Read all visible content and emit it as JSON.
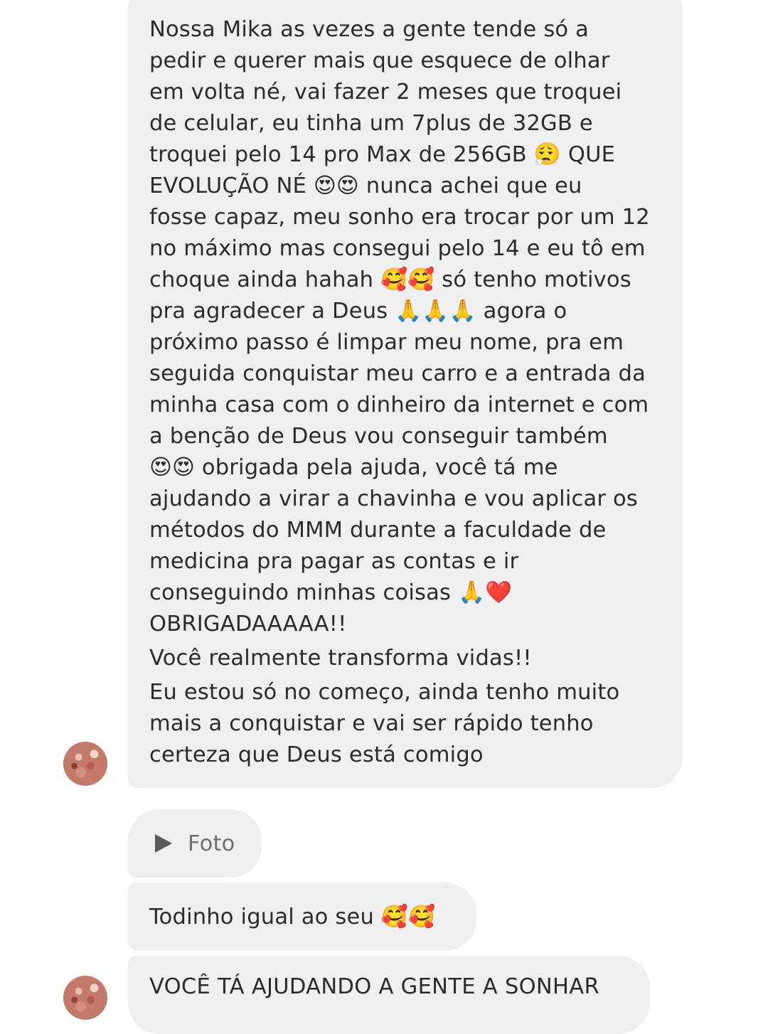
{
  "messages": [
    {
      "type": "text",
      "paragraphs": [
        "Nossa Mika as vezes a gente tende só a\npedir e querer mais que esquece de olhar\nem volta né, vai fazer 2 meses que troquei\nde celular, eu tinha um 7plus de 32GB e\ntroquei pelo 14 pro Max de 256GB 😮‍💨 QUE\nEVOLUÇÃO NÉ 😍😍 nunca achei que eu\nfosse capaz, meu sonho era trocar por um 12\nno máximo mas consegui pelo 14 e eu tô em\nchoque ainda hahah 🥰🥰 só tenho motivos\npra agradecer a Deus 🙏🙏🙏 agora o\npróximo passo é limpar meu nome, pra em\nseguida conquistar meu carro e a entrada da\nminha casa com o dinheiro da internet e com\na benção de Deus vou conseguir também\n😍😍 obrigada pela ajuda, você tá me\najudando a virar a chavinha e vou aplicar os\nmétodos do MMM durante a faculdade de\nmedicina pra pagar as contas e ir\nconseguindo minhas coisas 🙏❤️\nOBRIGADAAAAA!!",
        "Você realmente transforma vidas!!",
        "Eu estou só no começo, ainda tenho muito\nmais a conquistar e vai ser rápido tenho\ncerteza que Deus está comigo"
      ]
    },
    {
      "type": "attachment",
      "icon": "play-icon",
      "label": "Foto"
    },
    {
      "type": "text",
      "text": "Todinho igual ao seu 🥰🥰"
    },
    {
      "type": "text",
      "text": "VOCÊ TÁ AJUDANDO A GENTE A SONHAR"
    }
  ],
  "colors": {
    "bubble_bg": "#efeff0",
    "text": "#2b2b2b",
    "attachment_label": "#6f6f72",
    "page_bg": "#ffffff"
  }
}
